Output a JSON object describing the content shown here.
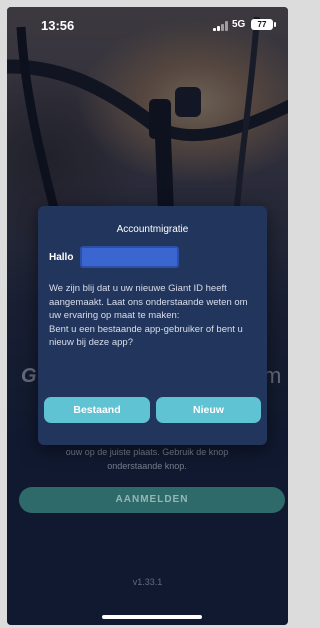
{
  "status_bar": {
    "time": "13:56",
    "network": "5G",
    "battery": "77"
  },
  "background": {
    "brand_left": "G",
    "brand_right": "m",
    "info_text": "ouw op de juiste plaats. Gebruik de knop onderstaande knop.",
    "login_button": "AANMELDEN",
    "version": "v1.33.1"
  },
  "dialog": {
    "title": "Accountmigratie",
    "greeting": "Hallo",
    "body_line1": "We zijn blij dat u uw nieuwe Giant ID heeft aangemaakt. Laat ons onderstaande weten om uw ervaring op maat te maken:",
    "body_line2": "Bent u een bestaande app-gebruiker of bent u nieuw bij deze app?",
    "existing_button": "Bestaand",
    "new_button": "Nieuw"
  },
  "colors": {
    "dialog_bg": "#22355d",
    "accent_button": "#5fc3d3",
    "name_field": "#3b66d0",
    "login_button": "#2f6a6a"
  }
}
